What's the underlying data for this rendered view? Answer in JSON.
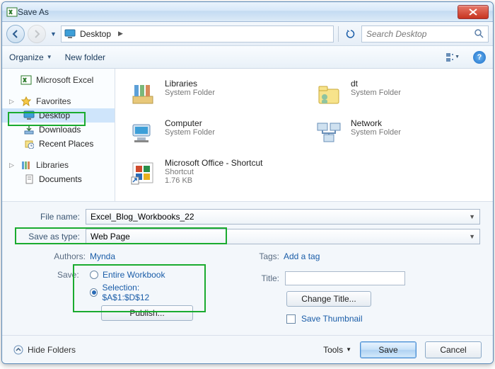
{
  "window": {
    "title": "Save As",
    "close": "X"
  },
  "nav": {
    "location_icon": "desktop",
    "location": "Desktop",
    "search_placeholder": "Search Desktop"
  },
  "toolbar": {
    "organize": "Organize",
    "newfolder": "New folder"
  },
  "navpane": {
    "excel": "Microsoft Excel",
    "favorites": "Favorites",
    "desktop": "Desktop",
    "downloads": "Downloads",
    "recent": "Recent Places",
    "libraries": "Libraries",
    "documents": "Documents"
  },
  "items": [
    {
      "name": "Libraries",
      "sub": "System Folder",
      "icon": "libraries"
    },
    {
      "name": "dt",
      "sub": "System Folder",
      "icon": "user"
    },
    {
      "name": "Computer",
      "sub": "System Folder",
      "icon": "computer"
    },
    {
      "name": "Network",
      "sub": "System Folder",
      "icon": "network"
    },
    {
      "name": "Microsoft Office - Shortcut",
      "sub": "Shortcut",
      "extra": "1.76 KB",
      "icon": "office"
    }
  ],
  "filename": {
    "label": "File name:",
    "value": "Excel_Blog_Workbooks_22"
  },
  "saveastype": {
    "label": "Save as type:",
    "value": "Web Page"
  },
  "meta": {
    "authors_label": "Authors:",
    "authors_value": "Mynda",
    "tags_label": "Tags:",
    "tags_value": "Add a tag"
  },
  "saveopts": {
    "label": "Save:",
    "entire": "Entire Workbook",
    "selection": "Selection: $A$1:$D$12",
    "publish": "Publish..."
  },
  "titlearea": {
    "label": "Title:",
    "change": "Change Title...",
    "thumb": "Save Thumbnail"
  },
  "footer": {
    "hide": "Hide Folders",
    "tools": "Tools",
    "save": "Save",
    "cancel": "Cancel"
  }
}
